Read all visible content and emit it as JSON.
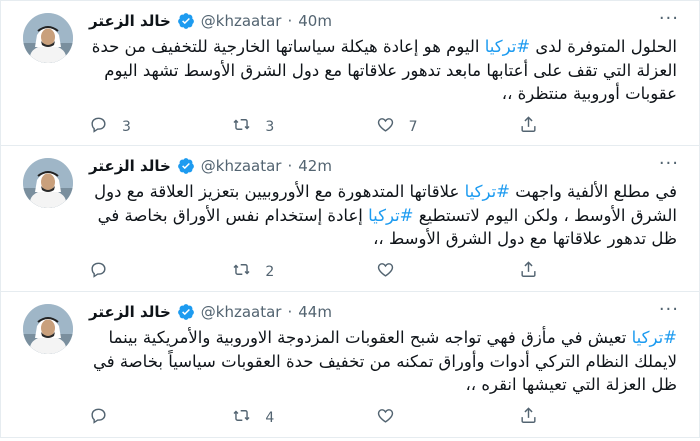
{
  "tweets": [
    {
      "author": "خالد الزعتر",
      "handle": "@khzaatar",
      "dot": "·",
      "time": "40m",
      "text_parts": [
        {
          "t": "الحلول المتوفرة لدى ",
          "tag": false
        },
        {
          "t": "#تركيا",
          "tag": true
        },
        {
          "t": " اليوم هو إعادة هيكلة سياساتها الخارجية للتخفيف من حدة العزلة التي تقف على أعتابها مابعد تدهور علاقاتها مع دول الشرق الأوسط تشهد اليوم عقوبات أوروبية منتظرة ،،",
          "tag": false
        }
      ],
      "replies": "3",
      "retweets": "3",
      "likes": "7"
    },
    {
      "author": "خالد الزعتر",
      "handle": "@khzaatar",
      "dot": "·",
      "time": "42m",
      "text_parts": [
        {
          "t": "في مطلع الألفية واجهت ",
          "tag": false
        },
        {
          "t": "#تركيا",
          "tag": true
        },
        {
          "t": " علاقاتها المتدهورة مع الأوروبيين بتعزيز العلاقة مع دول الشرق الأوسط ، ولكن اليوم لاتستطيع ",
          "tag": false
        },
        {
          "t": "#تركيا",
          "tag": true
        },
        {
          "t": " إعادة إستخدام نفس الأوراق بخاصة في ظل تدهور علاقاتها مع دول الشرق الأوسط ،،",
          "tag": false
        }
      ],
      "replies": "",
      "retweets": "2",
      "likes": ""
    },
    {
      "author": "خالد الزعتر",
      "handle": "@khzaatar",
      "dot": "·",
      "time": "44m",
      "text_parts": [
        {
          "t": "#تركيا",
          "tag": true
        },
        {
          "t": " تعيش في مأزق فهي تواجه شبح العقوبات المزدوجة الاوروبية والأمريكية بينما لايملك النظام التركي أدوات وأوراق تمكنه من تخفيف حدة العقوبات سياسياً بخاصة في ظل العزلة التي تعيشها انقره ،،",
          "tag": false
        }
      ],
      "replies": "",
      "retweets": "4",
      "likes": ""
    }
  ],
  "icons": {
    "reply": "reply-icon",
    "retweet": "retweet-icon",
    "like": "heart-icon",
    "share": "share-icon",
    "more": "more-icon",
    "verified": "verified-badge-icon"
  },
  "colors": {
    "hashtag": "#1d9bf0",
    "verified": "#1d9bf0",
    "secondary_text": "#536471",
    "border": "#e6ecf0"
  },
  "more_glyph": "···"
}
